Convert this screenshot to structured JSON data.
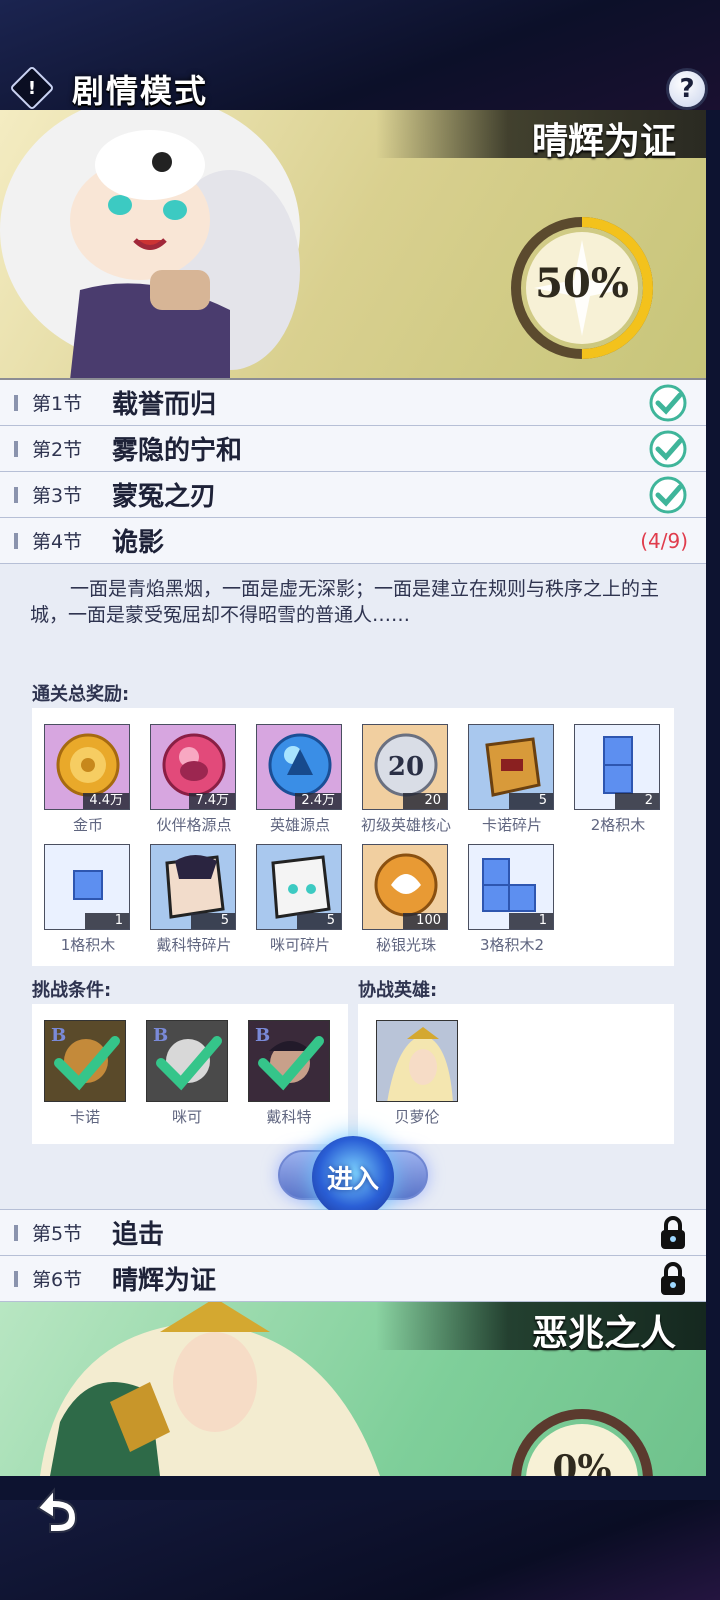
{
  "header": {
    "title": "剧情模式",
    "info_icon": "!",
    "help_icon": "?"
  },
  "current_banner": {
    "title": "晴辉为证",
    "progress_text": "50%",
    "progress_value": 0.5,
    "ring_color": "#f3c21c"
  },
  "chapters": [
    {
      "num": "第1节",
      "name": "载誉而归",
      "status": "complete"
    },
    {
      "num": "第2节",
      "name": "雾隐的宁和",
      "status": "complete"
    },
    {
      "num": "第3节",
      "name": "蒙冤之刃",
      "status": "complete"
    },
    {
      "num": "第4节",
      "name": "诡影",
      "status": "in-progress",
      "progress": "(4/9)"
    },
    {
      "num": "第5节",
      "name": "追击",
      "status": "locked"
    },
    {
      "num": "第6节",
      "name": "晴辉为证",
      "status": "locked"
    }
  ],
  "expanded": {
    "description": "一面是青焰黑烟，一面是虚无深影；一面是建立在规则与秩序之上的主城，一面是蒙受冤屈却不得昭雪的普通人……",
    "rewards_label": "通关总奖励:",
    "rewards": [
      {
        "label": "金币",
        "qty": "4.4万",
        "icon": "gold-coin-icon"
      },
      {
        "label": "伙伴格源点",
        "qty": "7.4万",
        "icon": "partner-orb-icon"
      },
      {
        "label": "英雄源点",
        "qty": "2.4万",
        "icon": "hero-orb-icon"
      },
      {
        "label": "初级英雄核心",
        "qty": "20",
        "icon": "hero-core-icon"
      },
      {
        "label": "卡诺碎片",
        "qty": "5",
        "icon": "kano-shard-icon"
      },
      {
        "label": "2格积木",
        "qty": "2",
        "icon": "block2-icon"
      },
      {
        "label": "1格积木",
        "qty": "1",
        "icon": "block1-icon"
      },
      {
        "label": "戴科特碎片",
        "qty": "5",
        "icon": "dekot-shard-icon"
      },
      {
        "label": "咪可碎片",
        "qty": "5",
        "icon": "miko-shard-icon"
      },
      {
        "label": "秘银光珠",
        "qty": "100",
        "icon": "mithril-pearl-icon"
      },
      {
        "label": "3格积木2",
        "qty": "1",
        "icon": "block3-icon"
      }
    ],
    "conditions_label": "挑战条件:",
    "conditions": [
      {
        "label": "卡诺",
        "badge": "B"
      },
      {
        "label": "咪可",
        "badge": "B"
      },
      {
        "label": "戴科特",
        "badge": "B"
      }
    ],
    "helpers_label": "协战英雄:",
    "helpers": [
      {
        "label": "贝萝伦"
      }
    ],
    "enter_label": "进入"
  },
  "next_banner": {
    "title": "恶兆之人",
    "progress_text": "0%"
  }
}
